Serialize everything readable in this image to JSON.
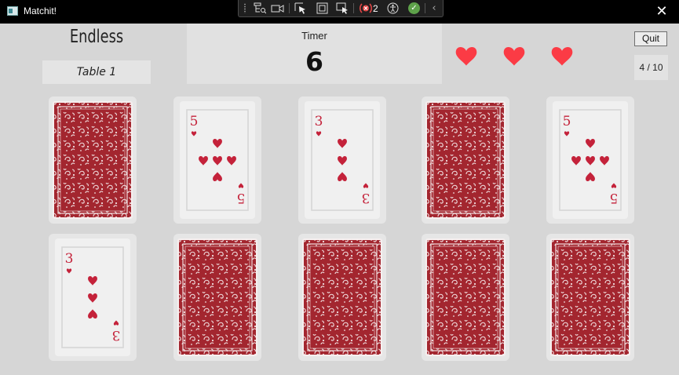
{
  "window": {
    "title": "Matchit!",
    "close_glyph": "✕"
  },
  "devtools": {
    "icons": [
      "grip-icon",
      "live-visual-tree-icon",
      "record-video-icon",
      "select-element-icon",
      "display-layout-adorners-icon",
      "track-focus-icon",
      "binding-failures-icon",
      "accessibility-icon",
      "checkmark-icon",
      "collapse-chevron-icon"
    ],
    "binding_failures_count": "2"
  },
  "header": {
    "mode": "Endless",
    "table": "Table 1",
    "timer_label": "Timer",
    "timer_value": "6",
    "quit_label": "Quit",
    "progress": "4 / 10"
  },
  "lives": {
    "remaining": 3,
    "total": 3,
    "color": "#fb3b45"
  },
  "colors": {
    "card_back": "#a3262f",
    "card_pip": "#c4223a",
    "background": "#d6d6d6"
  },
  "cards": [
    {
      "state": "face-down"
    },
    {
      "state": "face-up",
      "rank": "5",
      "suit": "hearts"
    },
    {
      "state": "face-up",
      "rank": "3",
      "suit": "hearts"
    },
    {
      "state": "face-down"
    },
    {
      "state": "face-up",
      "rank": "5",
      "suit": "hearts"
    },
    {
      "state": "face-up",
      "rank": "3",
      "suit": "hearts"
    },
    {
      "state": "face-down"
    },
    {
      "state": "face-down"
    },
    {
      "state": "face-down"
    },
    {
      "state": "face-down"
    }
  ]
}
